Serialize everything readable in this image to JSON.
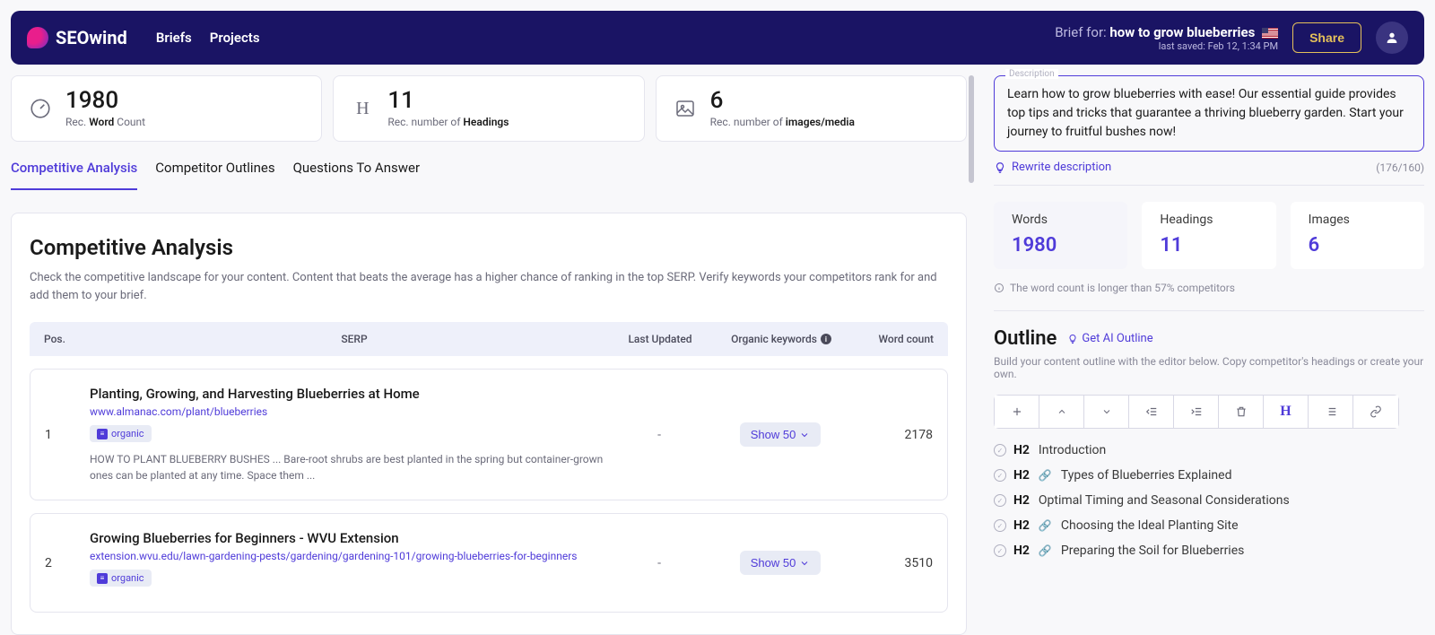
{
  "header": {
    "brand": "SEOwind",
    "nav": {
      "briefs": "Briefs",
      "projects": "Projects"
    },
    "brief_for_label": "Brief for:",
    "brief_title": "how to grow blueberries",
    "last_saved": "last saved: Feb 12, 1:34 PM",
    "share": "Share"
  },
  "stats": {
    "word_count": {
      "value": "1980",
      "label_pre": "Rec. ",
      "label_strong": "Word",
      "label_post": " Count"
    },
    "headings": {
      "value": "11",
      "label_pre": "Rec. number of ",
      "label_strong": "Headings",
      "label_post": ""
    },
    "images": {
      "value": "6",
      "label_pre": "Rec. number of ",
      "label_strong": "images/media",
      "label_post": ""
    }
  },
  "tabs": {
    "competitive": "Competitive Analysis",
    "outlines": "Competitor Outlines",
    "questions": "Questions To Answer"
  },
  "competitive": {
    "title": "Competitive Analysis",
    "desc": "Check the competitive landscape for your content. Content that beats the average has a higher chance of ranking in the top SERP. Verify keywords your competitors rank for and add them to your brief.",
    "headers": {
      "pos": "Pos.",
      "serp": "SERP",
      "updated": "Last Updated",
      "keywords": "Organic keywords",
      "words": "Word count"
    },
    "rows": [
      {
        "pos": "1",
        "title": "Planting, Growing, and Harvesting Blueberries at Home",
        "url": "www.almanac.com/plant/blueberries",
        "badge": "organic",
        "snippet": "HOW TO PLANT BLUEBERRY BUSHES ... Bare-root shrubs are best planted in the spring but container-grown ones can be planted at any time. Space them ...",
        "updated": "-",
        "show": "Show 50",
        "words": "2178"
      },
      {
        "pos": "2",
        "title": "Growing Blueberries for Beginners - WVU Extension",
        "url": "extension.wvu.edu/lawn-gardening-pests/gardening/gardening-101/growing-blueberries-for-beginners",
        "badge": "organic",
        "updated": "-",
        "show": "Show 50",
        "words": "3510"
      }
    ]
  },
  "right": {
    "desc_label": "Description",
    "desc_text": "Learn how to grow blueberries with ease! Our essential guide provides top tips and tricks that guarantee a thriving blueberry garden. Start your journey to fruitful bushes now!",
    "rewrite": "Rewrite description",
    "char_count": "(176/160)",
    "mini": {
      "words_label": "Words",
      "words_value": "1980",
      "headings_label": "Headings",
      "headings_value": "11",
      "images_label": "Images",
      "images_value": "6"
    },
    "competitor_note": "The word count is longer than 57% competitors",
    "outline_title": "Outline",
    "ai_outline": "Get AI Outline",
    "outline_desc": "Build your content outline with the editor below. Copy competitor's headings or create your own.",
    "outline_items": [
      {
        "tag": "H2",
        "link": false,
        "text": "Introduction"
      },
      {
        "tag": "H2",
        "link": true,
        "text": "Types of Blueberries Explained"
      },
      {
        "tag": "H2",
        "link": false,
        "text": "Optimal Timing and Seasonal Considerations"
      },
      {
        "tag": "H2",
        "link": true,
        "text": "Choosing the Ideal Planting Site"
      },
      {
        "tag": "H2",
        "link": true,
        "text": "Preparing the Soil for Blueberries"
      }
    ]
  }
}
